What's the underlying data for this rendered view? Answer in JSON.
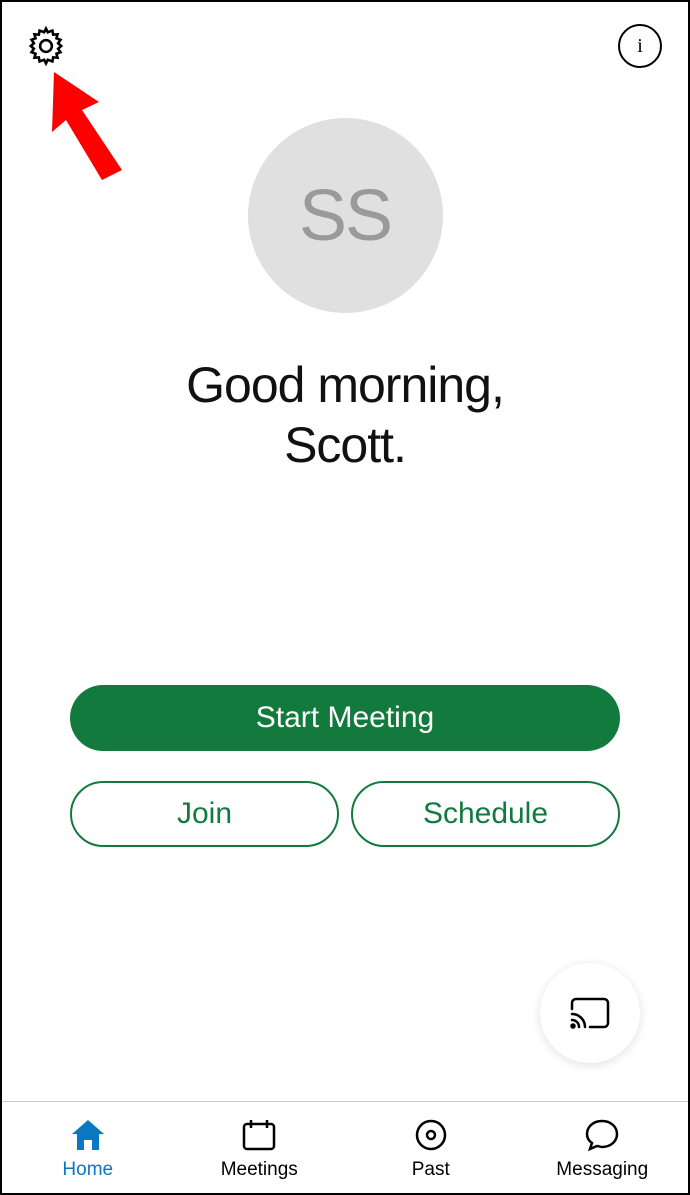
{
  "avatar": {
    "initials": "SS"
  },
  "greeting_line1": "Good morning,",
  "greeting_line2": "Scott.",
  "actions": {
    "start": "Start Meeting",
    "join": "Join",
    "schedule": "Schedule"
  },
  "tabs": {
    "home": "Home",
    "meetings": "Meetings",
    "past": "Past",
    "messaging": "Messaging"
  },
  "info_label": "i",
  "accent_color": "#137a3e",
  "active_tab_color": "#0b77c2"
}
